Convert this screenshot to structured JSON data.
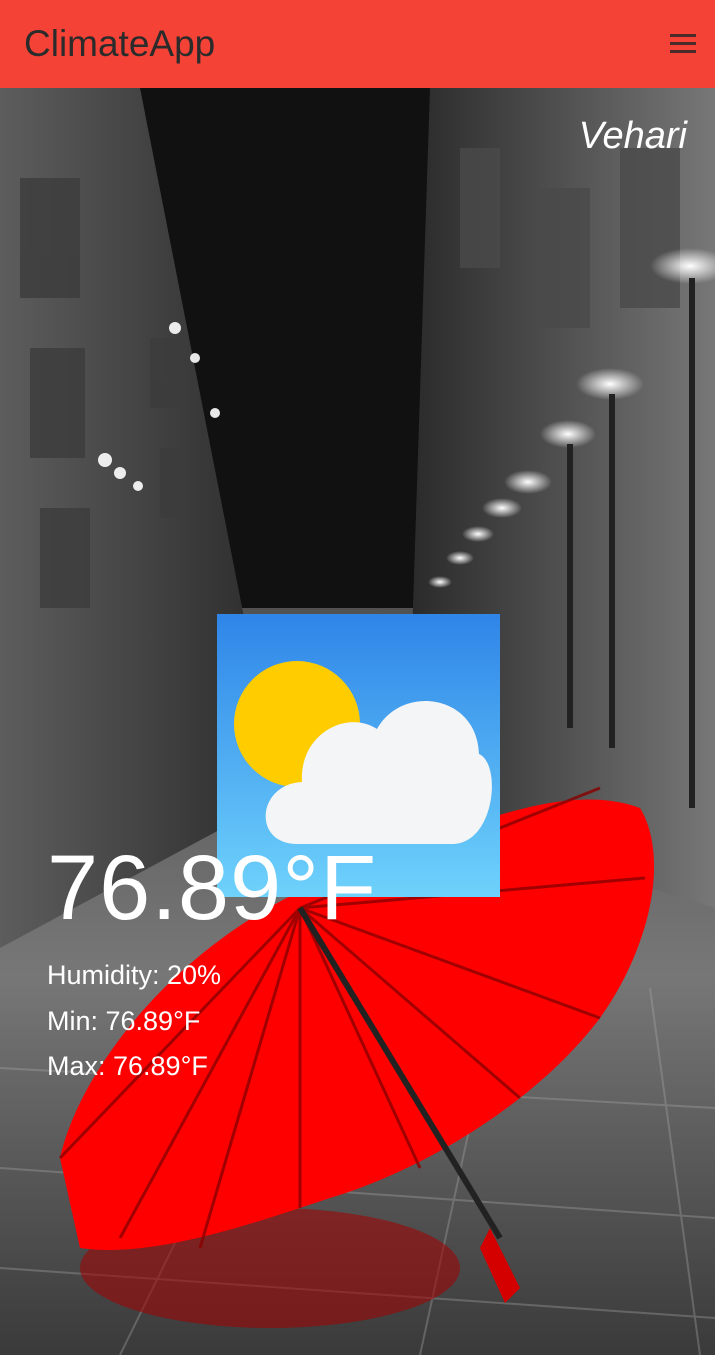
{
  "app_bar": {
    "title": "ClimateApp",
    "menu_icon": "hamburger-menu-icon",
    "color": "#f44336"
  },
  "weather": {
    "city": "Vehari",
    "temperature": "76.89°F",
    "humidity": "Humidity: 20%",
    "min": "Min: 76.89°F",
    "max": "Max: 76.89°F",
    "icon": "partly-cloudy-icon"
  },
  "background": {
    "description_icon": "rainy-street-red-umbrella-image"
  }
}
